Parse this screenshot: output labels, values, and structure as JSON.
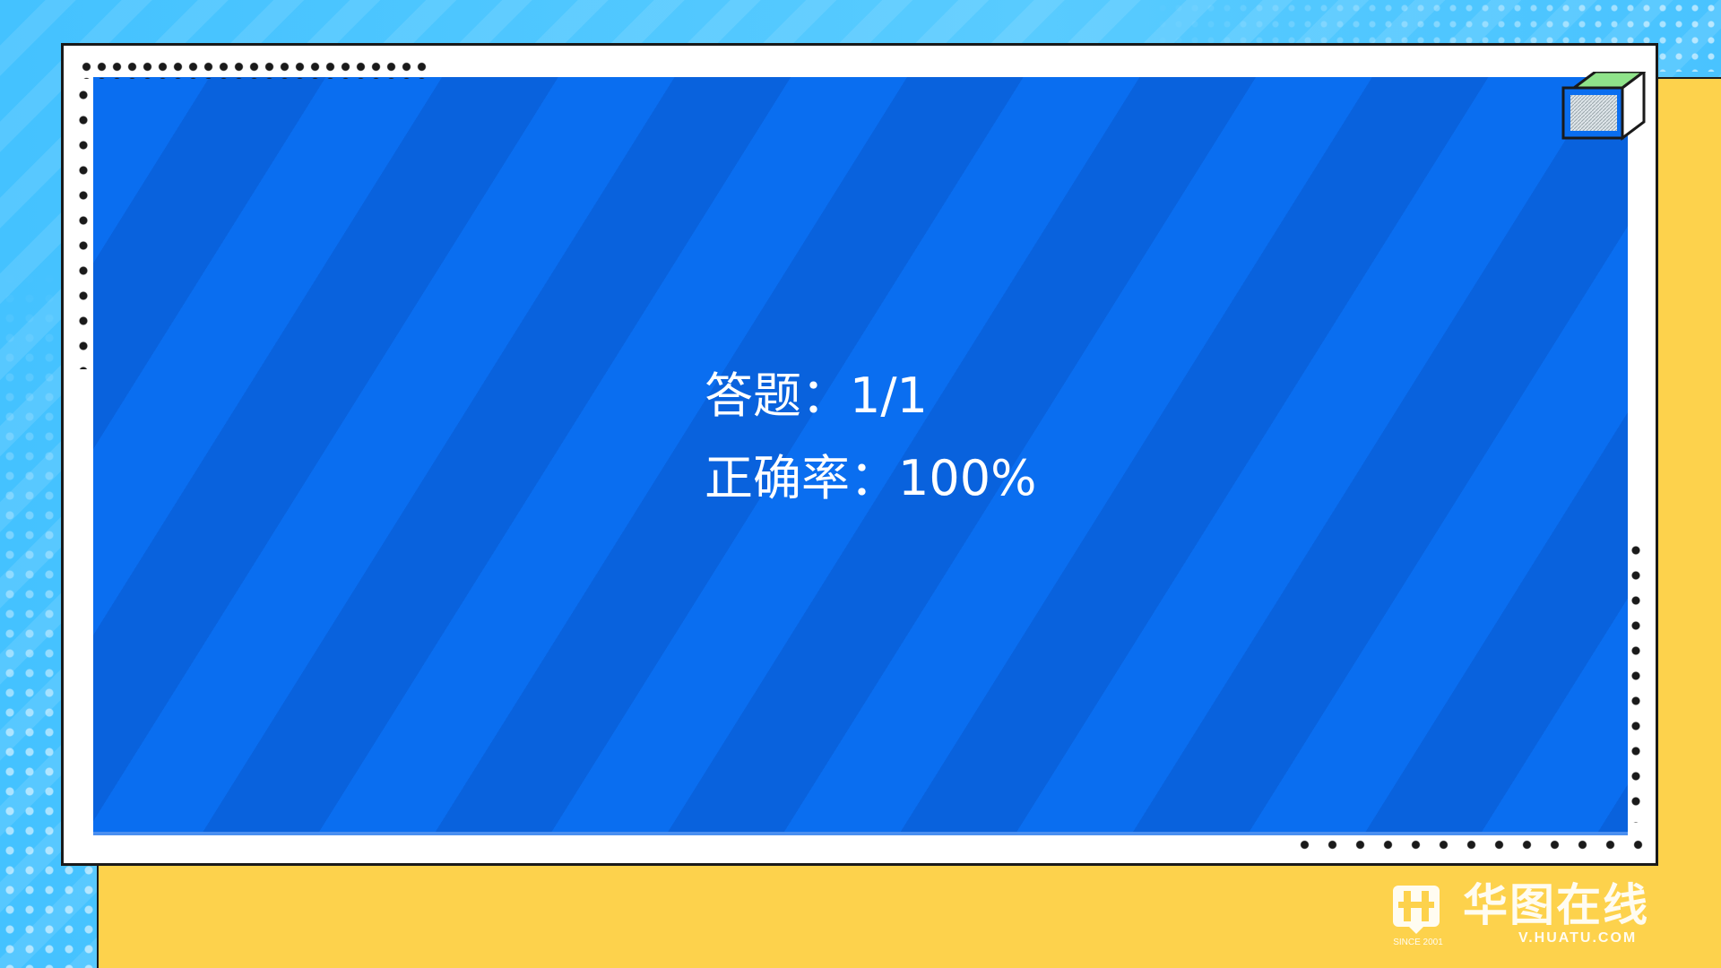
{
  "result": {
    "answered_label": "答题：",
    "answered_value": "1/1",
    "accuracy_label": "正确率：",
    "accuracy_value": "100%"
  },
  "logo": {
    "name": "华图在线",
    "url": "V.HUATU.COM",
    "since": "SINCE 2001"
  },
  "colors": {
    "panel_blue": "#0a6ef0",
    "panel_stripe": "#0962dd",
    "sky_blue": "#44c2ff",
    "accent_yellow": "#fdd24c",
    "frame_white": "#ffffff",
    "outline": "#1a1a1a"
  },
  "icons": {
    "cube": "cube-icon",
    "logo_mark": "huatu-logo-icon"
  }
}
